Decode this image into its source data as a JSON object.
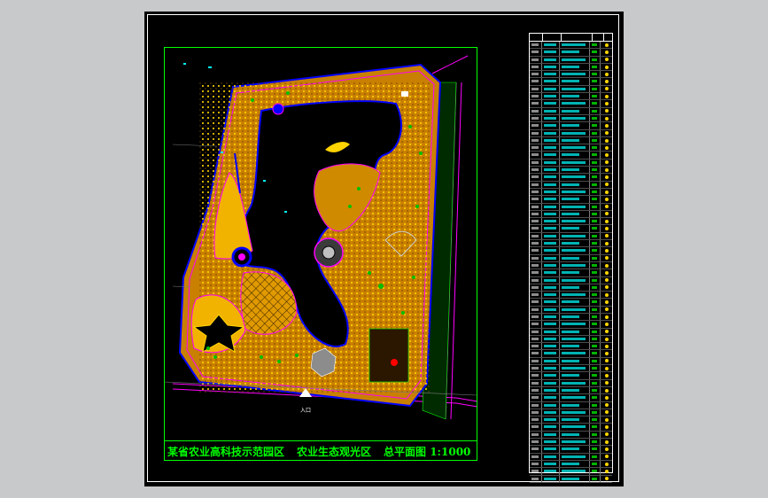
{
  "drawing": {
    "title_left": "某省农业高科技示范园区",
    "title_middle": "农业生态观光区",
    "title_right": "总平面图 1:1000",
    "entrance_label": "入口"
  },
  "legend": {
    "row_count": 60,
    "colors": {
      "cyan": "#00ffff",
      "yellow": "#ffd400",
      "green": "#00ff00",
      "white": "#ffffff"
    }
  },
  "colors": {
    "background": "#c8c9cb",
    "sheet": "#000000",
    "frame": "#00ff00",
    "land": "#e8a600",
    "path": "#ff00ff",
    "road": "#0000ff",
    "water": "#000000",
    "tree": "#00c000"
  }
}
